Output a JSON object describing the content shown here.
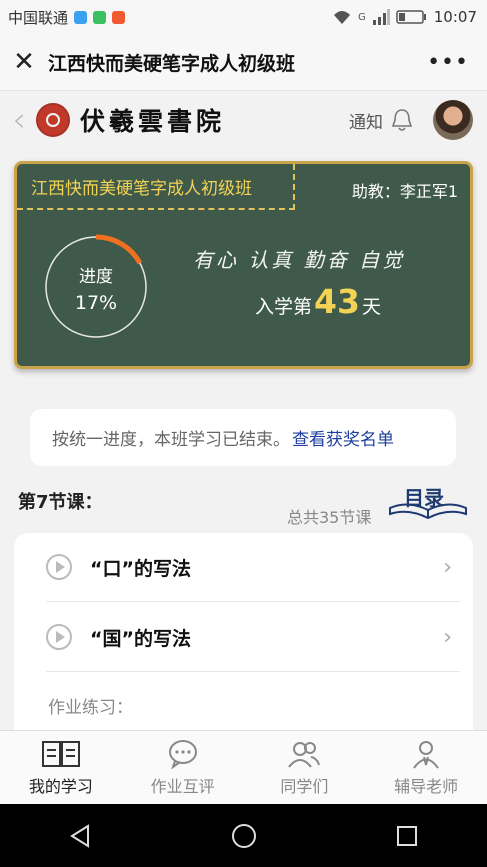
{
  "status_bar": {
    "carrier": "中国联通",
    "time": "10:07",
    "signal_label": "G"
  },
  "title_bar": {
    "title": "江西快而美硬笔字成人初级班"
  },
  "header": {
    "brand": "伏羲雲書院",
    "notify_label": "通知"
  },
  "board": {
    "class_name": "江西快而美硬笔字成人初级班",
    "assistant": "助教：李正军1",
    "progress_label": "进度",
    "progress_value": "17%",
    "progress_fraction": 0.17,
    "motto": "有心 认真 勤奋 自觉",
    "days_prefix": "入学第",
    "days_number": "43",
    "days_suffix": "天"
  },
  "notice": {
    "text": "按统一进度，本班学习已结束。",
    "link": "查看获奖名单"
  },
  "lesson": {
    "heading": "第7节课：",
    "total": "总共35节课",
    "catalog_label": "目录",
    "items": [
      {
        "title": "“口”的写法"
      },
      {
        "title": "“国”的写法"
      }
    ],
    "homework_label": "作业练习："
  },
  "tabs": [
    {
      "label": "我的学习",
      "active": true
    },
    {
      "label": "作业互评"
    },
    {
      "label": "同学们"
    },
    {
      "label": "辅导老师"
    }
  ],
  "colors": {
    "board": "#3f5a4a",
    "accent_orange": "#f07020",
    "accent_yellow": "#f3d256",
    "link_blue": "#1e3fa0"
  }
}
